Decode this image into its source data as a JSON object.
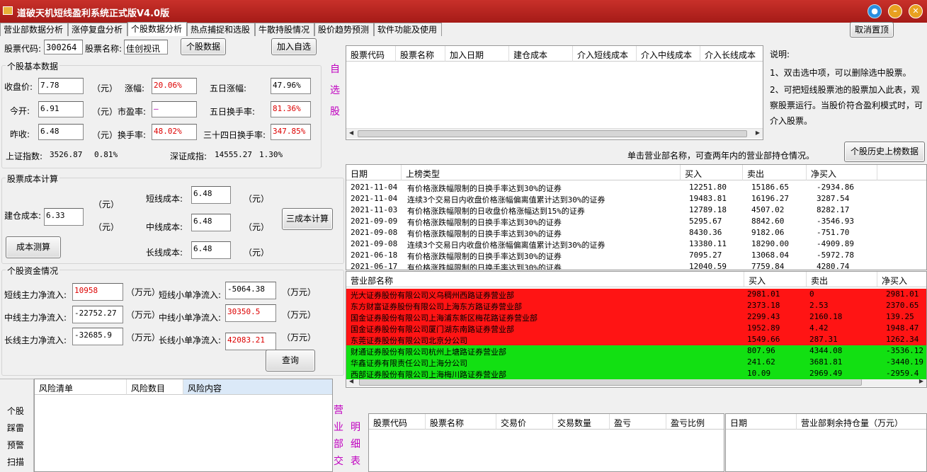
{
  "window": {
    "title": "道破天机短线盈利系统正式版V4.0版"
  },
  "tabs": [
    "营业部数据分析",
    "涨停复盘分析",
    "个股数据分析",
    "热点捕捉和选股",
    "牛散持股情况",
    "股价趋势预测",
    "软件功能及使用"
  ],
  "reset_label": "取消置顶",
  "stock": {
    "code_label": "股票代码:",
    "code": "300264",
    "name_label": "股票名称:",
    "name": "佳创视讯",
    "data_btn": "个股数据",
    "add_btn": "加入自选"
  },
  "basic": {
    "title": "个股基本数据",
    "close_label": "收盘价:",
    "close": "7.78",
    "open_label": "今开:",
    "open": "6.91",
    "prev_label": "昨收:",
    "prev": "6.48",
    "unit_yuan": "（元）",
    "chg_label": "涨幅:",
    "chg": "20.06%",
    "pe_label": "市盈率:",
    "pe": "—",
    "turn_label": "换手率:",
    "turn": "48.02%",
    "chg5_label": "五日涨幅:",
    "chg5": "47.96%",
    "turn5_label": "五日换手率:",
    "turn5": "81.36%",
    "turn34_label": "三十四日换手率:",
    "turn34": "347.85%",
    "sh_label": "上证指数:",
    "sh_val": "3526.87",
    "sh_pct": "0.81%",
    "sz_label": "深证成指:",
    "sz_val": "14555.27",
    "sz_pct": "1.30%"
  },
  "cost": {
    "title": "股票成本计算",
    "build_label": "建仓成本:",
    "build": "6.33",
    "unit": "（元）",
    "short_label": "短线成本:",
    "short": "6.48",
    "mid_label": "中线成本:",
    "mid": "6.48",
    "long_label": "长线成本:",
    "long": "6.48",
    "calc3_btn": "三成本计算",
    "measure_btn": "成本测算"
  },
  "fund": {
    "title": "个股资金情况",
    "unit": "（万元）",
    "s_main_label": "短线主力净流入:",
    "s_main": "10958",
    "m_main_label": "中线主力净流入:",
    "m_main": "-22752.27",
    "l_main_label": "长线主力净流入:",
    "l_main": "-32685.9",
    "s_small_label": "短线小单净流入:",
    "s_small": "-5064.38",
    "m_small_label": "中线小单净流入:",
    "m_small": "30350.5",
    "l_small_label": "长线小单净流入:",
    "l_small": "42083.21",
    "query_btn": "查询"
  },
  "risk": {
    "side": [
      "个股",
      "踩雷",
      "预警",
      "扫描"
    ],
    "cols": [
      "风险清单",
      "风险数目",
      "风险内容"
    ]
  },
  "watch": {
    "side": [
      "自",
      "选",
      "股"
    ],
    "cols": [
      "股票代码",
      "股票名称",
      "加入日期",
      "建仓成本",
      "介入短线成本",
      "介入中线成本",
      "介入长线成本"
    ]
  },
  "notes": {
    "title": "说明:",
    "l1": "1、双击选中项，可以删除选中股票。",
    "l2": "2、可把短线股票池的股票加入此表，观察股票运行。当股价符合盈利模式时，可介入股票。"
  },
  "hint": "单击营业部名称，可查两年内的营业部持仓情况。",
  "history_btn": "个股历史上榜数据",
  "lhb": {
    "cols": [
      "日期",
      "上榜类型",
      "买入",
      "卖出",
      "净买入"
    ],
    "rows": [
      [
        "2021-11-04",
        "有价格涨跌幅限制的日换手率达到30%的证券",
        "12251.80",
        "15186.65",
        "-2934.86"
      ],
      [
        "2021-11-04",
        "连续3个交易日内收盘价格涨幅偏离值累计达到30%的证券",
        "19483.81",
        "16196.27",
        "3287.54"
      ],
      [
        "2021-11-03",
        "有价格涨跌幅限制的日收盘价格涨幅达到15%的证券",
        "12789.18",
        "4507.02",
        "8282.17"
      ],
      [
        "2021-09-09",
        "有价格涨跌幅限制的日换手率达到30%的证券",
        "5295.67",
        "8842.60",
        "-3546.93"
      ],
      [
        "2021-09-08",
        "有价格涨跌幅限制的日换手率达到30%的证券",
        "8430.36",
        "9182.06",
        "-751.70"
      ],
      [
        "2021-09-08",
        "连续3个交易日内收盘价格涨幅偏离值累计达到30%的证券",
        "13380.11",
        "18290.00",
        "-4909.89"
      ],
      [
        "2021-06-18",
        "有价格涨跌幅限制的日换手率达到30%的证券",
        "7095.27",
        "13068.04",
        "-5972.78"
      ],
      [
        "2021-06-17",
        "有价格涨跌幅限制的日换手率达到30%的证券",
        "12040.59",
        "7759.84",
        "4280.74"
      ]
    ]
  },
  "brokers": {
    "cols": [
      "营业部名称",
      "买入",
      "卖出",
      "净买入"
    ],
    "red": "#ff1414",
    "green": "#12e012",
    "rows": [
      [
        "光大证券股份有限公司义乌稠州西路证券营业部",
        "2981.01",
        "0",
        "2981.01",
        "red"
      ],
      [
        "东方财富证券股份有限公司上海东方路证券营业部",
        "2373.18",
        "2.53",
        "2370.65",
        "red"
      ],
      [
        "国金证券股份有限公司上海浦东新区梅花路证券营业部",
        "2299.43",
        "2160.18",
        "139.25",
        "red"
      ],
      [
        "国金证券股份有限公司厦门湖东南路证券营业部",
        "1952.89",
        "4.42",
        "1948.47",
        "red"
      ],
      [
        "东莞证券股份有限公司北京分公司",
        "1549.66",
        "287.31",
        "1262.34",
        "red"
      ],
      [
        "财通证券股份有限公司杭州上塘路证券营业部",
        "807.96",
        "4344.08",
        "-3536.12",
        "green"
      ],
      [
        "华鑫证券有限责任公司上海分公司",
        "241.62",
        "3681.81",
        "-3440.19",
        "green"
      ],
      [
        "西部证券股份有限公司上海梅川路证券营业部",
        "10.09",
        "2969.49",
        "-2959.4",
        "green"
      ]
    ]
  },
  "detail": {
    "side1": [
      "营",
      "业",
      "部",
      "交"
    ],
    "side2": [
      "明",
      "细",
      "表"
    ],
    "cols": [
      "股票代码",
      "股票名称",
      "交易价",
      "交易数量",
      "盈亏",
      "盈亏比例"
    ],
    "cols2": [
      "日期",
      "营业部剩余持仓量（万元）"
    ]
  },
  "colors": {
    "title": "#b82520",
    "accent_text": "#e00000",
    "side_text": "#c000c0"
  }
}
